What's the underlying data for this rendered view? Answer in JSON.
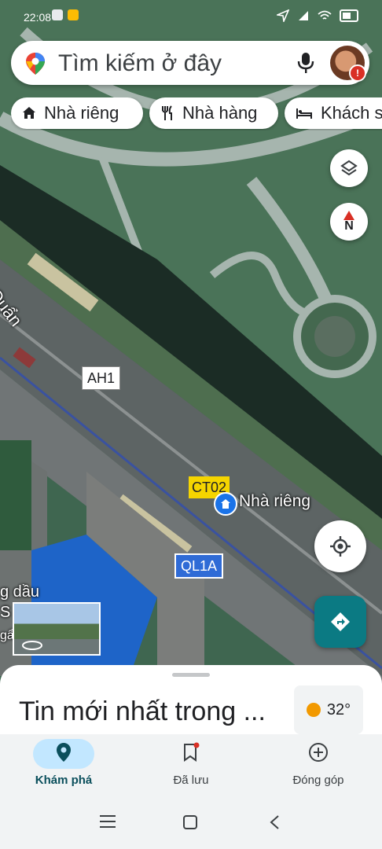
{
  "status_bar": {
    "time": "22:08"
  },
  "search": {
    "placeholder": "Tìm kiếm ở đây"
  },
  "chips": [
    {
      "label": "Nhà riêng",
      "icon": "home-icon"
    },
    {
      "label": "Nhà hàng",
      "icon": "restaurant-icon"
    },
    {
      "label": "Khách s",
      "icon": "hotel-icon"
    }
  ],
  "map": {
    "compass_label": "N",
    "road_labels": {
      "street_fragment": "Quẩn",
      "ah": "AH1",
      "ct": "CT02",
      "ql": "QL1A"
    },
    "place_label": "Nhà riêng",
    "left_edge_labels": {
      "fuel": "g dầu",
      "s": "S",
      "other": "gẩ"
    }
  },
  "sheet": {
    "title": "Tin mới nhất trong ...",
    "weather": "32°"
  },
  "nav": [
    {
      "label": "Khám phá",
      "icon": "explore-pin-icon",
      "active": true
    },
    {
      "label": "Đã lưu",
      "icon": "bookmark-icon",
      "active": false
    },
    {
      "label": "Đóng góp",
      "icon": "add-circle-icon",
      "active": false
    }
  ],
  "colors": {
    "accent": "#0b7a83",
    "active_pill": "#c2e7ff",
    "ct_shield": "#f5d500",
    "ql_shield": "#2f6bd6",
    "home_pin": "#1a73e8"
  }
}
